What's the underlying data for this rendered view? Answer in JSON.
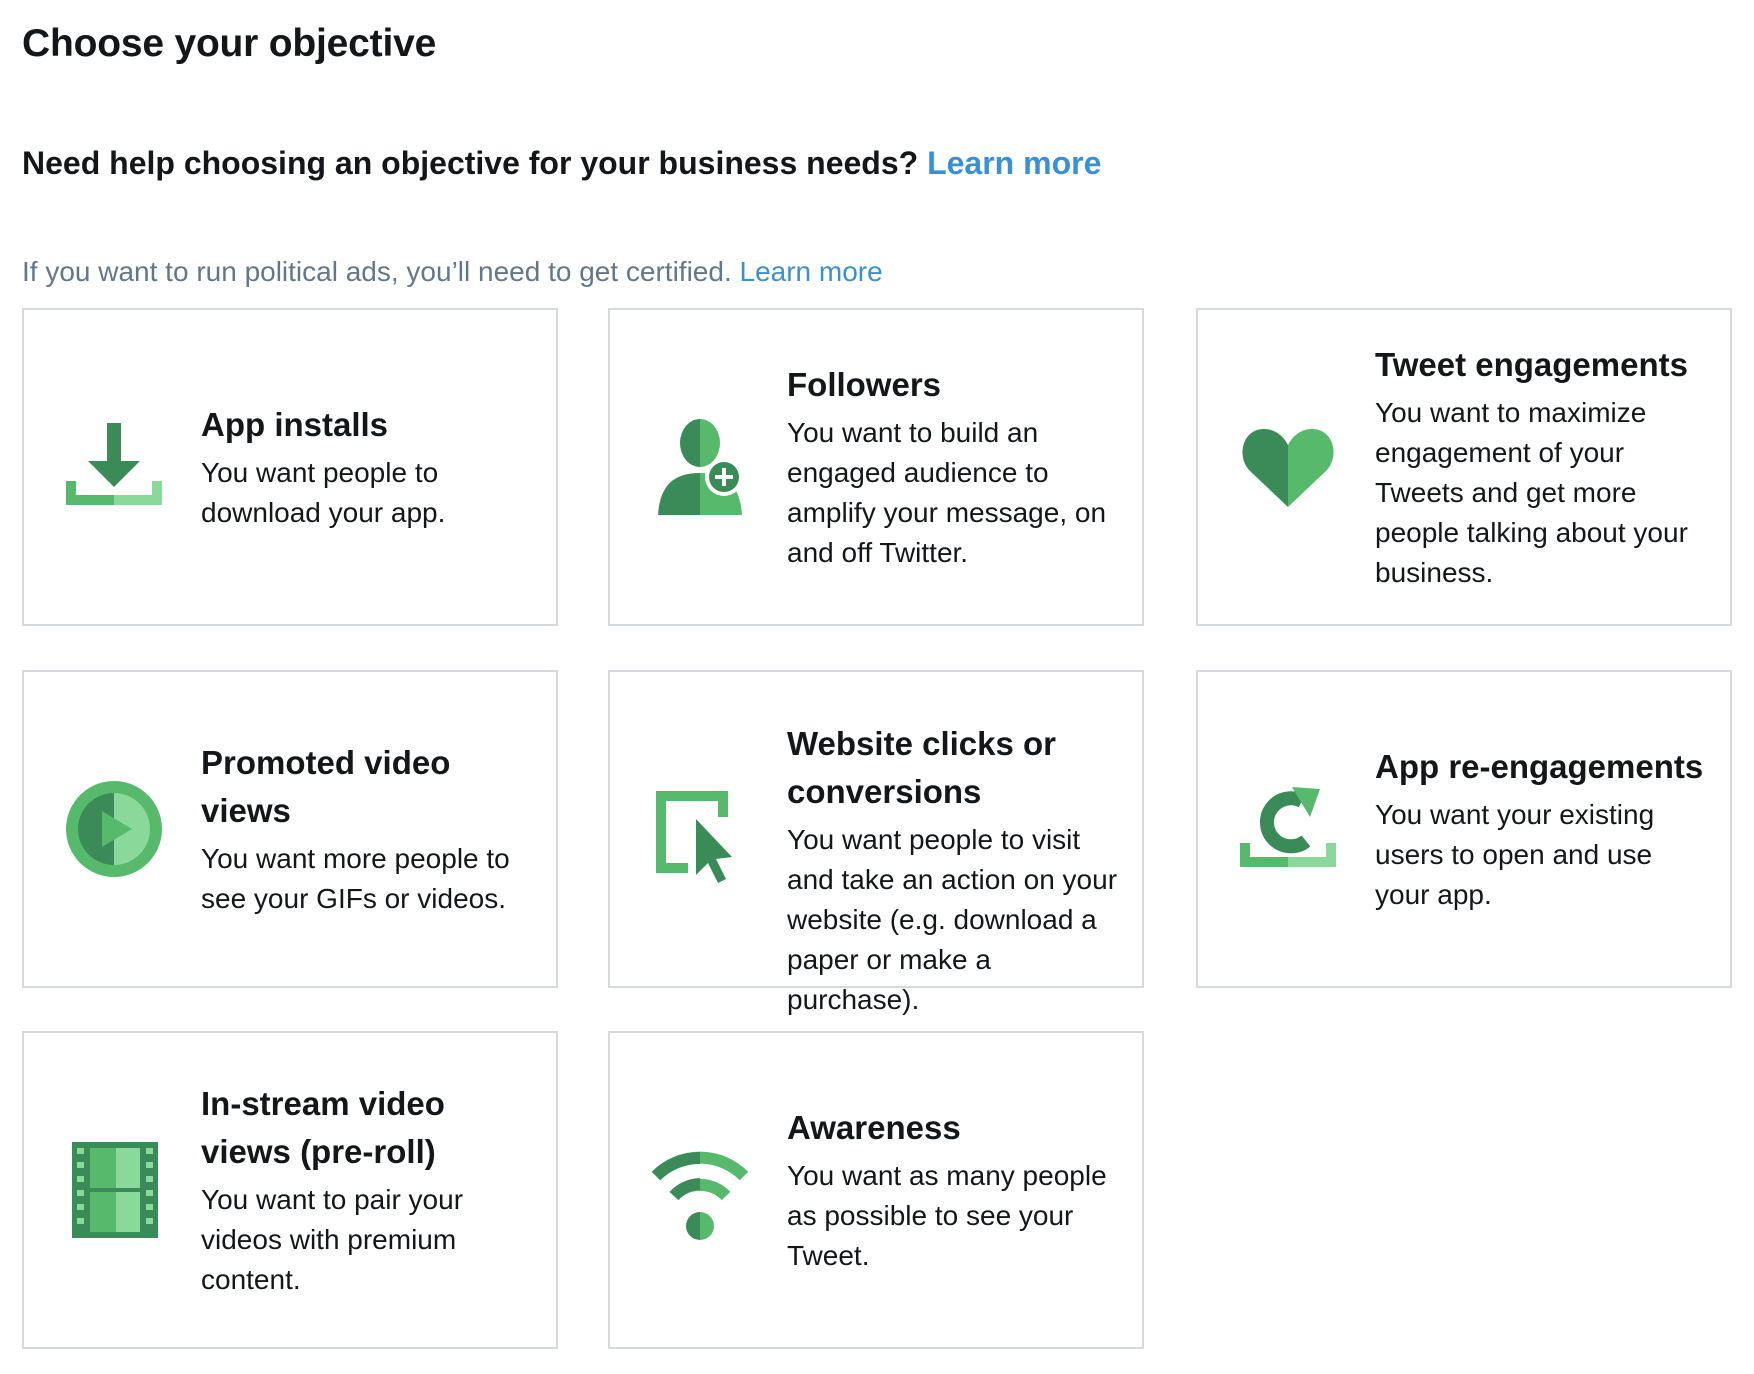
{
  "title": "Choose your objective",
  "help": {
    "text": "Need help choosing an objective for your business needs?",
    "link": "Learn more"
  },
  "political": {
    "text": "If you want to run political ads, you’ll need to get certified.",
    "link": "Learn more"
  },
  "colors": {
    "dark_green": "#3a8b57",
    "mid_green": "#57b96b",
    "light_green": "#8ad99b",
    "link_blue": "#3a8fd6",
    "border": "#d6dadd"
  },
  "objectives": [
    {
      "icon": "download-icon",
      "title": "App installs",
      "description": "You want people to download your app."
    },
    {
      "icon": "add-follower-icon",
      "title": "Followers",
      "description": "You want to build an engaged audience to amplify your message, on and off Twitter."
    },
    {
      "icon": "heart-icon",
      "title": "Tweet engagements",
      "description": "You want to maximize engagement of your Tweets and get more people talking about your business."
    },
    {
      "icon": "play-icon",
      "title": "Promoted video views",
      "description": "You want more people to see your GIFs or videos."
    },
    {
      "icon": "cursor-click-icon",
      "title": "Website clicks or conversions",
      "description": "You want people to visit and take an action on your website (e.g. download a paper or make a purchase)."
    },
    {
      "icon": "refresh-icon",
      "title": "App re-engagements",
      "description": "You want your existing users to open and use your app."
    },
    {
      "icon": "film-strip-icon",
      "title": "In-stream video views (pre-roll)",
      "description": "You want to pair your videos with premium content."
    },
    {
      "icon": "wifi-icon",
      "title": "Awareness",
      "description": "You want as many people as possible to see your Tweet."
    }
  ]
}
